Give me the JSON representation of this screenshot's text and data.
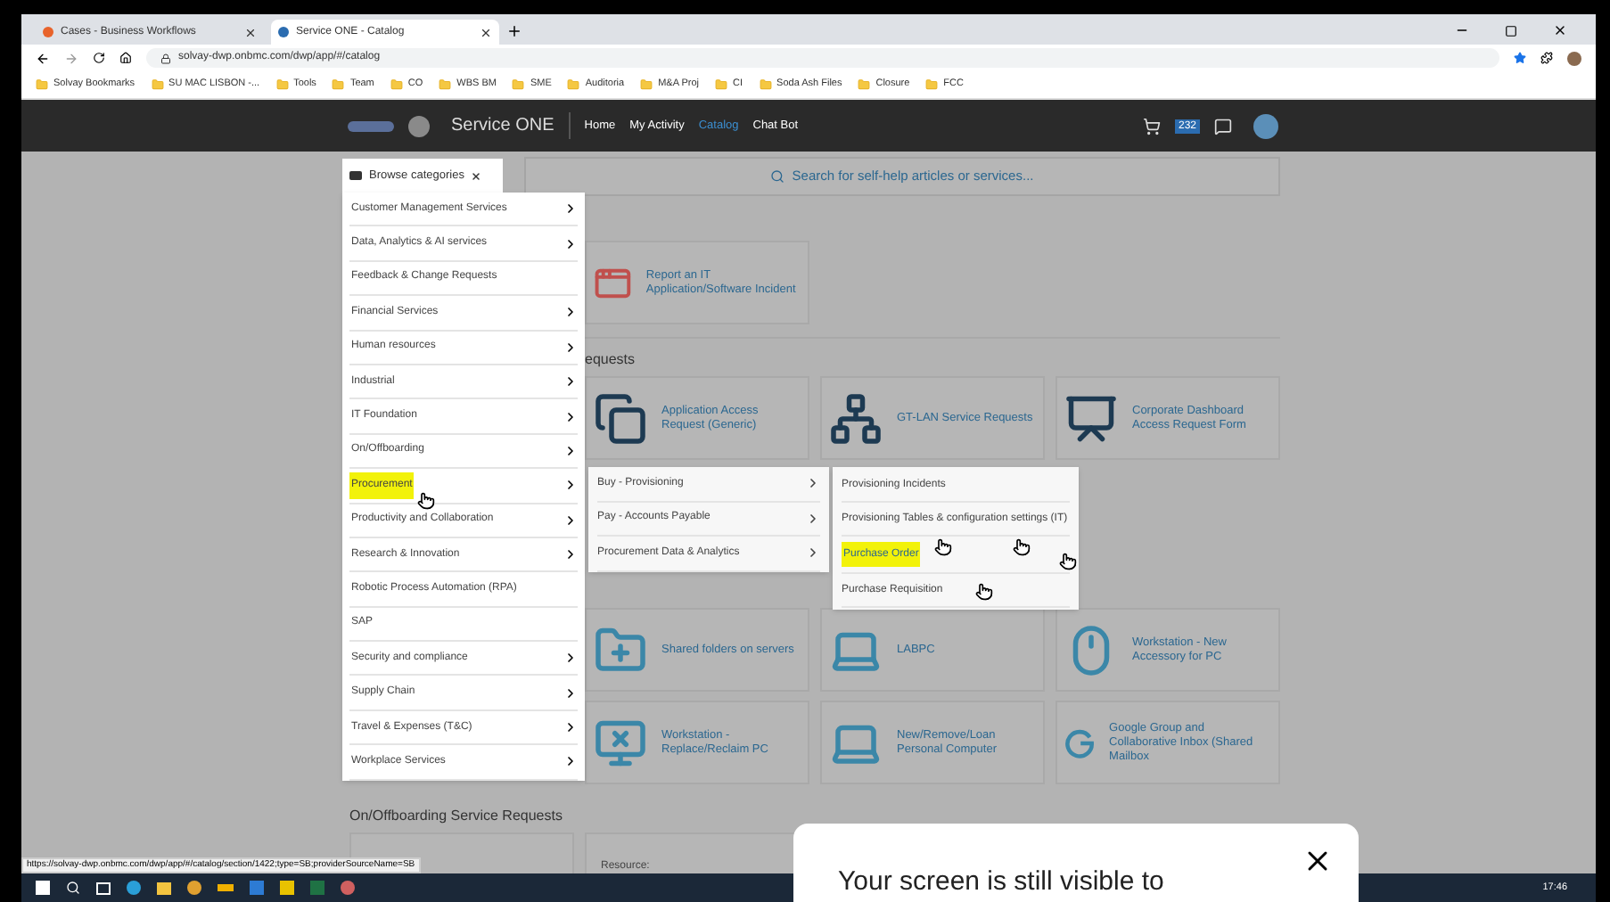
{
  "browser": {
    "tabs": [
      {
        "label": "Cases - Business Workflows",
        "selected": false
      },
      {
        "label": "Service ONE - Catalog",
        "selected": true
      }
    ],
    "address": "solvay-dwp.onbmc.com/dwp/app/#/catalog",
    "bookmarks": [
      "Solvay Bookmarks",
      "SU MAC LISBON -...",
      "Tools",
      "Team",
      "CO",
      "WBS BM",
      "SME",
      "Auditoria",
      "M&A Proj",
      "CI",
      "Soda Ash Files",
      "Closure",
      "FCC"
    ]
  },
  "header": {
    "app_name": "Service ONE",
    "nav": [
      {
        "label": "Home",
        "selected": false
      },
      {
        "label": "My Activity",
        "selected": false
      },
      {
        "label": "Catalog",
        "selected": true
      },
      {
        "label": "Chat Bot",
        "selected": false
      }
    ],
    "notification_count": "232"
  },
  "browse_button": {
    "label": "Browse categories"
  },
  "search": {
    "placeholder": "Search for self-help articles or services..."
  },
  "category_menu": [
    {
      "label": "Customer Management Services",
      "has_children": true,
      "highlighted": false
    },
    {
      "label": "Data, Analytics & AI services",
      "has_children": true,
      "highlighted": false
    },
    {
      "label": "Feedback & Change Requests",
      "has_children": false,
      "highlighted": false
    },
    {
      "label": "Financial Services",
      "has_children": true,
      "highlighted": false
    },
    {
      "label": "Human resources",
      "has_children": true,
      "highlighted": false
    },
    {
      "label": "Industrial",
      "has_children": true,
      "highlighted": false
    },
    {
      "label": "IT Foundation",
      "has_children": true,
      "highlighted": false
    },
    {
      "label": "On/Offboarding",
      "has_children": true,
      "highlighted": false
    },
    {
      "label": "Procurement",
      "has_children": true,
      "highlighted": true
    },
    {
      "label": "Productivity and Collaboration",
      "has_children": true,
      "highlighted": false
    },
    {
      "label": "Research & Innovation",
      "has_children": true,
      "highlighted": false
    },
    {
      "label": "Robotic Process Automation (RPA)",
      "has_children": false,
      "highlighted": false
    },
    {
      "label": "SAP",
      "has_children": false,
      "highlighted": false
    },
    {
      "label": "Security and compliance",
      "has_children": true,
      "highlighted": false
    },
    {
      "label": "Supply Chain",
      "has_children": true,
      "highlighted": false
    },
    {
      "label": "Travel & Expenses (T&C)",
      "has_children": true,
      "highlighted": false
    },
    {
      "label": "Workplace Services",
      "has_children": true,
      "highlighted": false
    }
  ],
  "submenu": [
    {
      "label": "Buy - Provisioning",
      "has_children": true
    },
    {
      "label": "Pay - Accounts Payable",
      "has_children": true
    },
    {
      "label": "Procurement Data & Analytics",
      "has_children": true
    }
  ],
  "subsubmenu": [
    {
      "label": "Provisioning Incidents",
      "highlighted": false
    },
    {
      "label": "Provisioning Tables & configuration settings (IT)",
      "highlighted": false
    },
    {
      "label": "Purchase Order",
      "highlighted": true
    },
    {
      "label": "Purchase Requisition",
      "highlighted": false
    }
  ],
  "featured": [
    {
      "title": "Report an IT Application/Software Incident"
    }
  ],
  "requests_heading": "equests",
  "request_tiles": [
    {
      "title": "Application Access Request (Generic)"
    },
    {
      "title": "GT-LAN Service Requests"
    },
    {
      "title": "Corporate Dashboard Access Request Form"
    },
    {
      "title": "Shared folders on servers"
    },
    {
      "title": "LABPC"
    },
    {
      "title": "Workstation - New Accessory for PC"
    },
    {
      "title": "Workstation - Replace/Reclaim PC"
    },
    {
      "title": "New/Remove/Loan Personal Computer"
    },
    {
      "title": "Google Group and Collaborative Inbox (Shared Mailbox"
    }
  ],
  "onboarding": {
    "heading": "On/Offboarding Service Requests",
    "tile_text": "Resource:"
  },
  "status_url": "https://solvay-dwp.onbmc.com/dwp/app/#/catalog/section/1422;type=SB;providerSourceName=SB",
  "taskbar": {
    "time": "17:46"
  },
  "share_notice": {
    "text": "Your screen is still visible to"
  }
}
